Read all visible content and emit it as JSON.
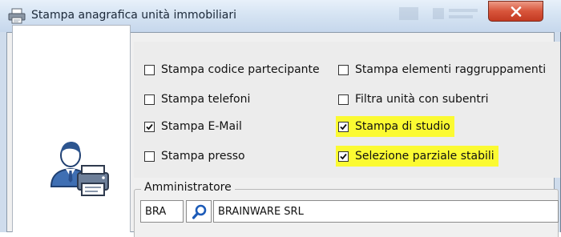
{
  "window": {
    "title": "Stampa anagrafica unità immobiliari",
    "title_icon": "printer-icon",
    "close_icon": "close-icon"
  },
  "options": [
    {
      "label": "Stampa codice partecipante",
      "checked": false,
      "highlighted": false
    },
    {
      "label": "Stampa elementi raggruppamenti",
      "checked": false,
      "highlighted": false
    },
    {
      "label": "Stampa telefoni",
      "checked": false,
      "highlighted": false
    },
    {
      "label": "Filtra unità con subentri",
      "checked": false,
      "highlighted": false
    },
    {
      "label": "Stampa E-Mail",
      "checked": true,
      "highlighted": false
    },
    {
      "label": "Stampa di studio",
      "checked": true,
      "highlighted": true
    },
    {
      "label": "Stampa presso",
      "checked": false,
      "highlighted": false
    },
    {
      "label": "Selezione parziale stabili",
      "checked": true,
      "highlighted": true
    }
  ],
  "administrator": {
    "legend": "Amministratore",
    "code": "BRA",
    "name": "BRAINWARE SRL",
    "lookup_icon": "search-icon"
  },
  "colors": {
    "highlight": "#fbfa32",
    "close_button": "#c94a33",
    "titlebar": "#d6e4f3"
  }
}
